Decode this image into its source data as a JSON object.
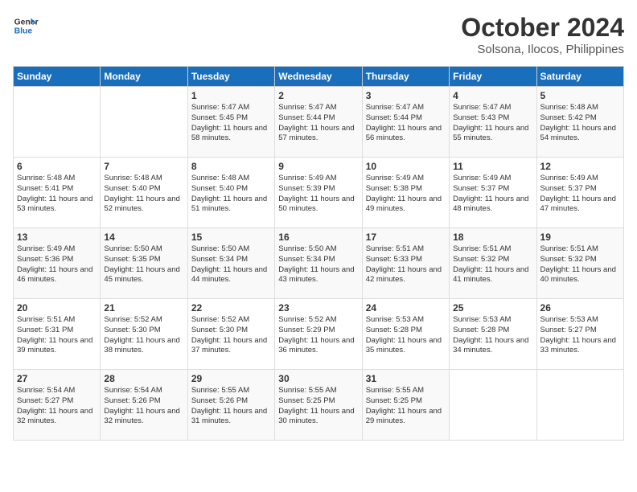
{
  "header": {
    "logo_line1": "General",
    "logo_line2": "Blue",
    "month": "October 2024",
    "location": "Solsona, Ilocos, Philippines"
  },
  "days_of_week": [
    "Sunday",
    "Monday",
    "Tuesday",
    "Wednesday",
    "Thursday",
    "Friday",
    "Saturday"
  ],
  "weeks": [
    [
      {
        "day": "",
        "info": ""
      },
      {
        "day": "",
        "info": ""
      },
      {
        "day": "1",
        "info": "Sunrise: 5:47 AM\nSunset: 5:45 PM\nDaylight: 11 hours and 58 minutes."
      },
      {
        "day": "2",
        "info": "Sunrise: 5:47 AM\nSunset: 5:44 PM\nDaylight: 11 hours and 57 minutes."
      },
      {
        "day": "3",
        "info": "Sunrise: 5:47 AM\nSunset: 5:44 PM\nDaylight: 11 hours and 56 minutes."
      },
      {
        "day": "4",
        "info": "Sunrise: 5:47 AM\nSunset: 5:43 PM\nDaylight: 11 hours and 55 minutes."
      },
      {
        "day": "5",
        "info": "Sunrise: 5:48 AM\nSunset: 5:42 PM\nDaylight: 11 hours and 54 minutes."
      }
    ],
    [
      {
        "day": "6",
        "info": "Sunrise: 5:48 AM\nSunset: 5:41 PM\nDaylight: 11 hours and 53 minutes."
      },
      {
        "day": "7",
        "info": "Sunrise: 5:48 AM\nSunset: 5:40 PM\nDaylight: 11 hours and 52 minutes."
      },
      {
        "day": "8",
        "info": "Sunrise: 5:48 AM\nSunset: 5:40 PM\nDaylight: 11 hours and 51 minutes."
      },
      {
        "day": "9",
        "info": "Sunrise: 5:49 AM\nSunset: 5:39 PM\nDaylight: 11 hours and 50 minutes."
      },
      {
        "day": "10",
        "info": "Sunrise: 5:49 AM\nSunset: 5:38 PM\nDaylight: 11 hours and 49 minutes."
      },
      {
        "day": "11",
        "info": "Sunrise: 5:49 AM\nSunset: 5:37 PM\nDaylight: 11 hours and 48 minutes."
      },
      {
        "day": "12",
        "info": "Sunrise: 5:49 AM\nSunset: 5:37 PM\nDaylight: 11 hours and 47 minutes."
      }
    ],
    [
      {
        "day": "13",
        "info": "Sunrise: 5:49 AM\nSunset: 5:36 PM\nDaylight: 11 hours and 46 minutes."
      },
      {
        "day": "14",
        "info": "Sunrise: 5:50 AM\nSunset: 5:35 PM\nDaylight: 11 hours and 45 minutes."
      },
      {
        "day": "15",
        "info": "Sunrise: 5:50 AM\nSunset: 5:34 PM\nDaylight: 11 hours and 44 minutes."
      },
      {
        "day": "16",
        "info": "Sunrise: 5:50 AM\nSunset: 5:34 PM\nDaylight: 11 hours and 43 minutes."
      },
      {
        "day": "17",
        "info": "Sunrise: 5:51 AM\nSunset: 5:33 PM\nDaylight: 11 hours and 42 minutes."
      },
      {
        "day": "18",
        "info": "Sunrise: 5:51 AM\nSunset: 5:32 PM\nDaylight: 11 hours and 41 minutes."
      },
      {
        "day": "19",
        "info": "Sunrise: 5:51 AM\nSunset: 5:32 PM\nDaylight: 11 hours and 40 minutes."
      }
    ],
    [
      {
        "day": "20",
        "info": "Sunrise: 5:51 AM\nSunset: 5:31 PM\nDaylight: 11 hours and 39 minutes."
      },
      {
        "day": "21",
        "info": "Sunrise: 5:52 AM\nSunset: 5:30 PM\nDaylight: 11 hours and 38 minutes."
      },
      {
        "day": "22",
        "info": "Sunrise: 5:52 AM\nSunset: 5:30 PM\nDaylight: 11 hours and 37 minutes."
      },
      {
        "day": "23",
        "info": "Sunrise: 5:52 AM\nSunset: 5:29 PM\nDaylight: 11 hours and 36 minutes."
      },
      {
        "day": "24",
        "info": "Sunrise: 5:53 AM\nSunset: 5:28 PM\nDaylight: 11 hours and 35 minutes."
      },
      {
        "day": "25",
        "info": "Sunrise: 5:53 AM\nSunset: 5:28 PM\nDaylight: 11 hours and 34 minutes."
      },
      {
        "day": "26",
        "info": "Sunrise: 5:53 AM\nSunset: 5:27 PM\nDaylight: 11 hours and 33 minutes."
      }
    ],
    [
      {
        "day": "27",
        "info": "Sunrise: 5:54 AM\nSunset: 5:27 PM\nDaylight: 11 hours and 32 minutes."
      },
      {
        "day": "28",
        "info": "Sunrise: 5:54 AM\nSunset: 5:26 PM\nDaylight: 11 hours and 32 minutes."
      },
      {
        "day": "29",
        "info": "Sunrise: 5:55 AM\nSunset: 5:26 PM\nDaylight: 11 hours and 31 minutes."
      },
      {
        "day": "30",
        "info": "Sunrise: 5:55 AM\nSunset: 5:25 PM\nDaylight: 11 hours and 30 minutes."
      },
      {
        "day": "31",
        "info": "Sunrise: 5:55 AM\nSunset: 5:25 PM\nDaylight: 11 hours and 29 minutes."
      },
      {
        "day": "",
        "info": ""
      },
      {
        "day": "",
        "info": ""
      }
    ]
  ]
}
